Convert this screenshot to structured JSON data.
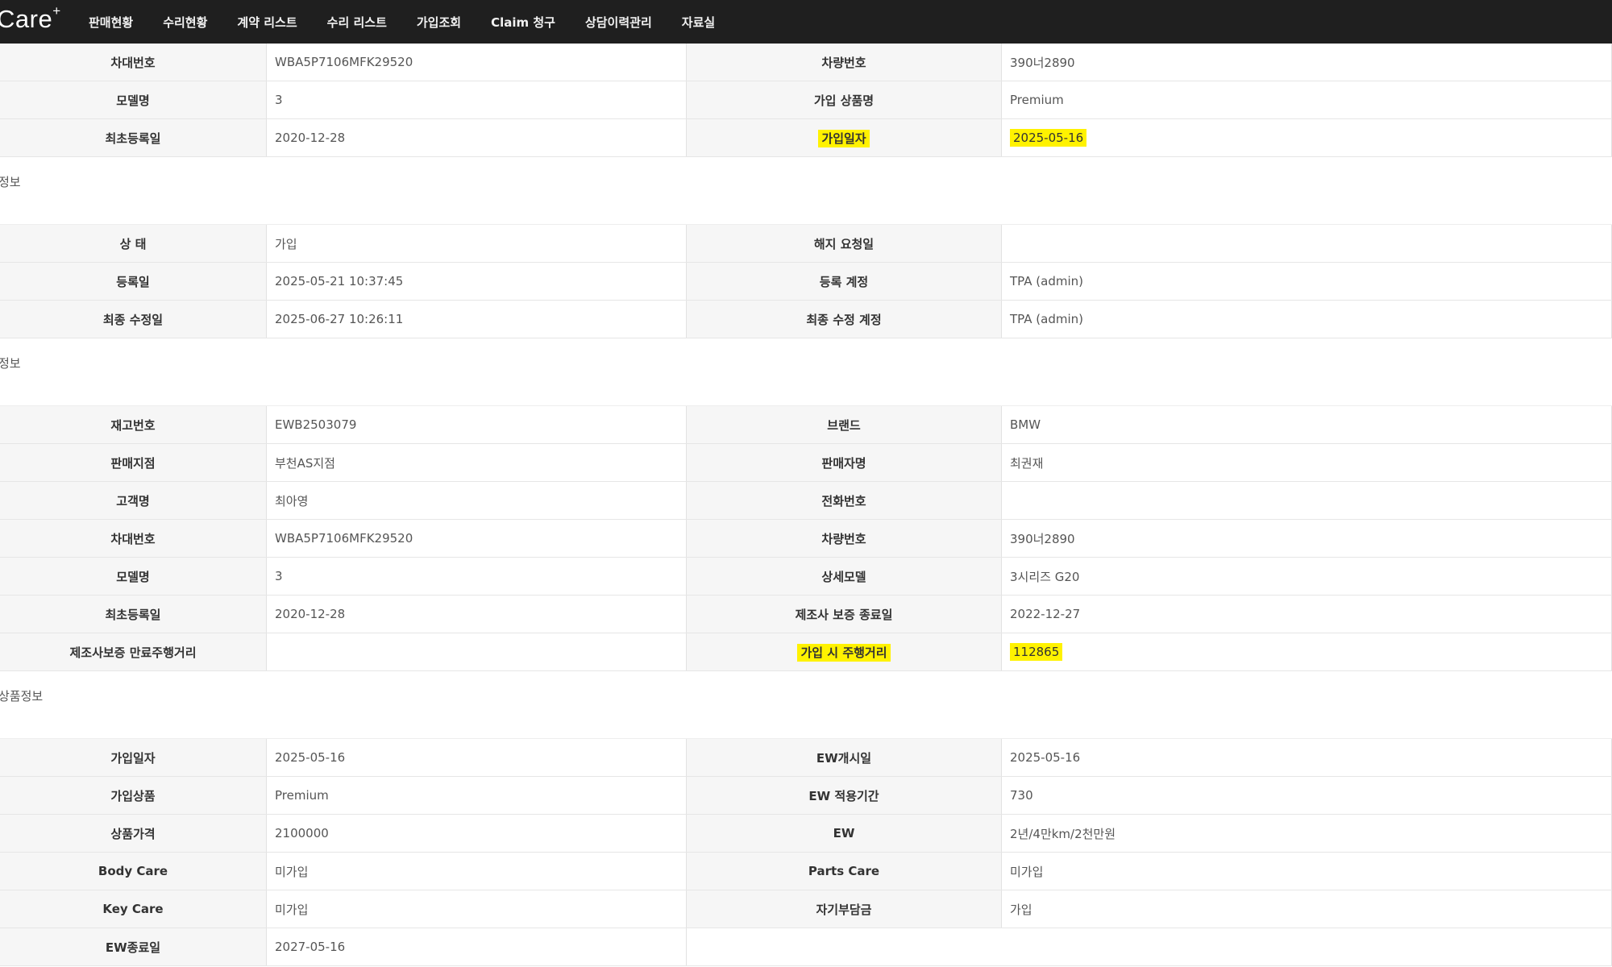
{
  "header": {
    "logo": "Care",
    "logo_sup": "+",
    "nav": [
      "판매현황",
      "수리현황",
      "계약 리스트",
      "수리 리스트",
      "가입조회",
      "Claim 청구",
      "상담이력관리",
      "자료실"
    ]
  },
  "sections": [
    {
      "title": "",
      "rows": [
        {
          "l1": "차대번호",
          "v1": "WBA5P7106MFK29520",
          "l2": "차량번호",
          "v2": "390너2890"
        },
        {
          "l1": "모델명",
          "v1": "3",
          "l2": "가입 상품명",
          "v2": "Premium"
        },
        {
          "l1": "최초등록일",
          "v1": "2020-12-28",
          "l2": "가입일자",
          "v2": "2025-05-16"
        }
      ]
    },
    {
      "title": "정보",
      "rows": [
        {
          "l1": "상 태",
          "v1": "가입",
          "l2": "해지 요청일",
          "v2": ""
        },
        {
          "l1": "등록일",
          "v1": "2025-05-21 10:37:45",
          "l2": "등록 계정",
          "v2": "TPA (admin)"
        },
        {
          "l1": "최종 수정일",
          "v1": "2025-06-27 10:26:11",
          "l2": "최종 수정 계정",
          "v2": "TPA (admin)"
        }
      ]
    },
    {
      "title": "정보",
      "rows": [
        {
          "l1": "재고번호",
          "v1": "EWB2503079",
          "l2": "브랜드",
          "v2": "BMW"
        },
        {
          "l1": "판매지점",
          "v1": "부천AS지점",
          "l2": "판매자명",
          "v2": "최권재"
        },
        {
          "l1": "고객명",
          "v1": "최아영",
          "l2": "전화번호",
          "v2": ""
        },
        {
          "l1": "차대번호",
          "v1": "WBA5P7106MFK29520",
          "l2": "차량번호",
          "v2": "390너2890"
        },
        {
          "l1": "모델명",
          "v1": "3",
          "l2": "상세모델",
          "v2": "3시리즈 G20"
        },
        {
          "l1": "최초등록일",
          "v1": "2020-12-28",
          "l2": "제조사 보증 종료일",
          "v2": "2022-12-27"
        },
        {
          "l1": "제조사보증 만료주행거리",
          "v1": "",
          "l2": "가입 시 주행거리",
          "v2": "112865"
        }
      ]
    },
    {
      "title": "상품정보",
      "rows": [
        {
          "l1": "가입일자",
          "v1": "2025-05-16",
          "l2": "EW개시일",
          "v2": "2025-05-16"
        },
        {
          "l1": "가입상품",
          "v1": "Premium",
          "l2": "EW 적용기간",
          "v2": "730"
        },
        {
          "l1": "상품가격",
          "v1": "2100000",
          "l2": "EW",
          "v2": "2년/4만km/2천만원"
        },
        {
          "l1": "Body Care",
          "v1": "미가입",
          "l2": "Parts Care",
          "v2": "미가입"
        },
        {
          "l1": "Key Care",
          "v1": "미가입",
          "l2": "자기부담금",
          "v2": "가입"
        },
        {
          "l1": "EW종료일",
          "v1": "2027-05-16",
          "l2": "",
          "v2": ""
        }
      ]
    }
  ],
  "highlight_color": "#fff200"
}
